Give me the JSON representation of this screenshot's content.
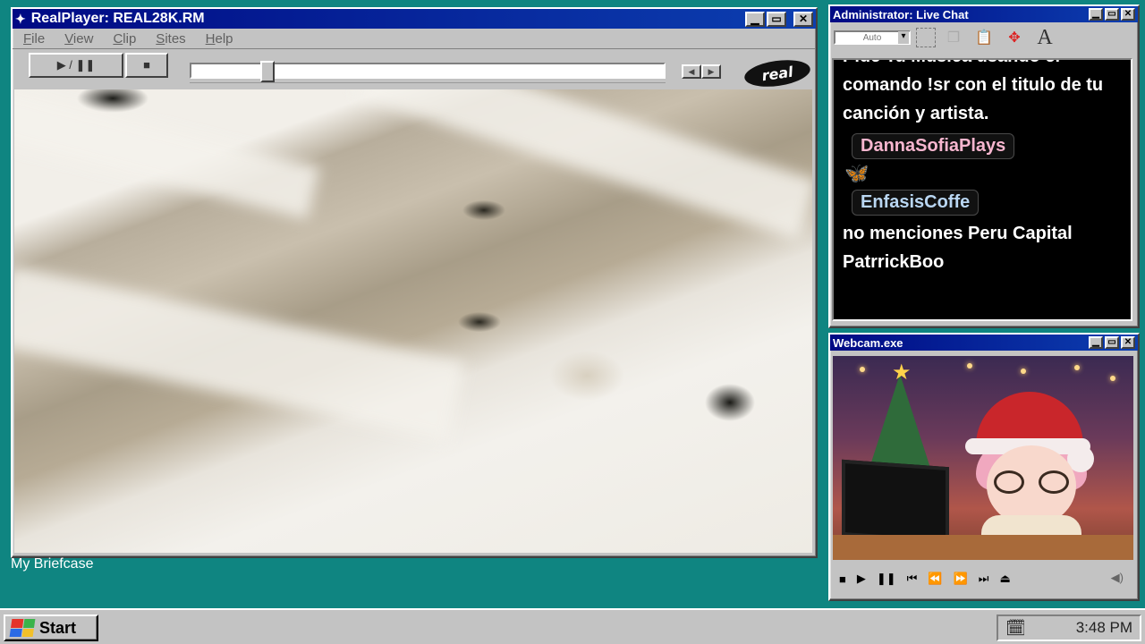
{
  "realplayer": {
    "title": "RealPlayer: REAL28K.RM",
    "menu": [
      "File",
      "View",
      "Clip",
      "Sites",
      "Help"
    ],
    "play_pause_label": "▶ / ❚❚",
    "stop_label": "■",
    "brand": "real",
    "seek_progress": 0.15
  },
  "desktop": {
    "briefcase_label": "My Briefcase"
  },
  "chat": {
    "title": "Administrator: Live Chat",
    "font_select": "Auto",
    "tools": [
      "selection-tool",
      "copy-tool",
      "paste-tool",
      "move-tool",
      "font-tool"
    ],
    "font_tool_label": "A",
    "partial_top": "Pide Tu Musica usando el",
    "message_1": "comando !sr con el titulo de tu canción y artista.",
    "user_1": "DannaSofiaPlays",
    "emote_1": "🦋",
    "user_2": "EnfasisCoffe",
    "message_2": "no menciones Peru Capital",
    "message_3": "PatrrickBoo"
  },
  "webcam": {
    "title": "Webcam.exe",
    "controls": [
      "■",
      "▶",
      "❚❚",
      "⏮",
      "⏪",
      "⏩",
      "⏭",
      "⏏"
    ],
    "volume": "◀)"
  },
  "taskbar": {
    "start_label": "Start",
    "clock": "3:48 PM"
  },
  "colors": {
    "desktop": "#0f8581",
    "titlebar": "#000a84",
    "window": "#c3c3c3"
  }
}
